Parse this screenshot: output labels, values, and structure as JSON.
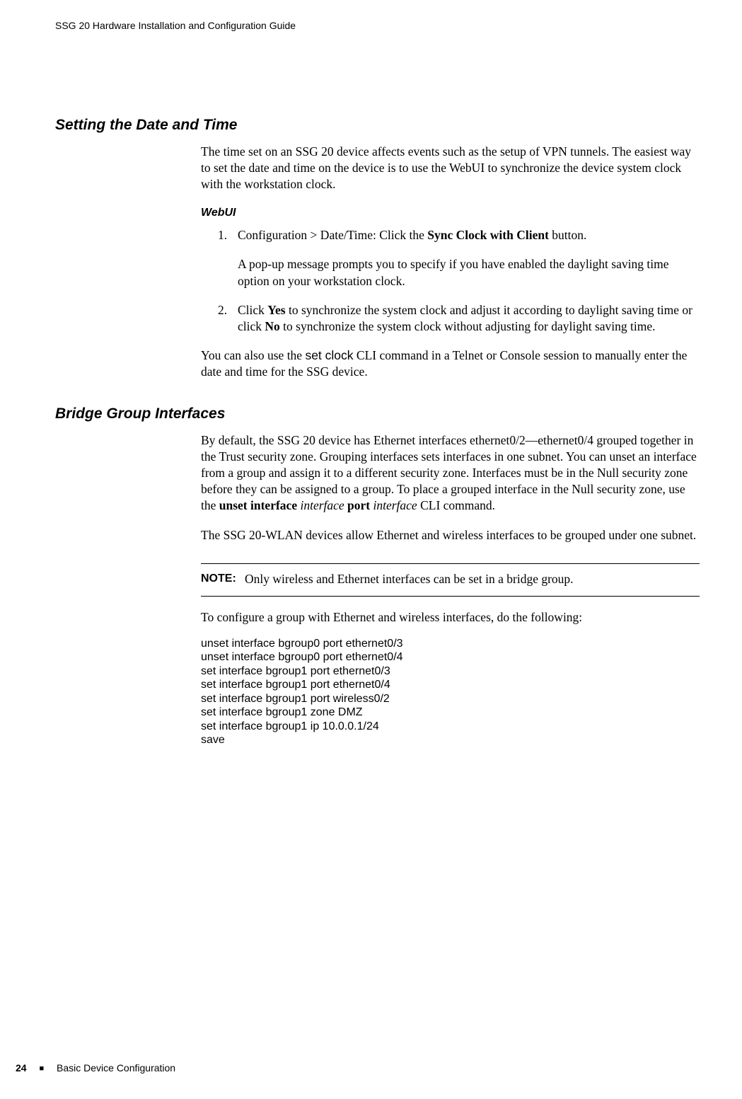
{
  "header": {
    "running_title": "SSG 20 Hardware Installation and Configuration Guide"
  },
  "sections": {
    "date_time": {
      "heading": "Setting the Date and Time",
      "intro": "The time set on an SSG 20 device affects events such as the setup of VPN tunnels. The easiest way to set the date and time on the device is to use the WebUI to synchronize the device system clock with the workstation clock.",
      "webui_label": "WebUI",
      "step1_num": "1.",
      "step1_prefix": "Configuration > Date/Time: Click the ",
      "step1_bold": "Sync Clock with Client",
      "step1_suffix": " button.",
      "step1_para2": "A pop-up message prompts you to specify if you have enabled the daylight saving time option on your workstation clock.",
      "step2_num": "2.",
      "step2_prefix": "Click ",
      "step2_bold1": "Yes",
      "step2_mid1": " to synchronize the system clock and adjust it according to daylight saving time or click ",
      "step2_bold2": "No",
      "step2_mid2": " to synchronize the system clock without adjusting for daylight saving time.",
      "cli_para_prefix": "You can also use the ",
      "cli_cmd": "set clock",
      "cli_para_suffix": " CLI command in a Telnet or Console session to manually enter the date and time for the SSG device."
    },
    "bgroup": {
      "heading": "Bridge Group Interfaces",
      "p1_pre": "By default, the SSG 20 device has Ethernet interfaces ethernet0/2—ethernet0/4 grouped together in the Trust security zone. Grouping interfaces sets interfaces in one subnet. You can unset an interface from a group and assign it to a different security zone. Interfaces must be in the Null security zone before they can be assigned to a group. To place a grouped interface in the Null security zone, use the ",
      "p1_bold1": "unset interface",
      "p1_ital1": " interface ",
      "p1_bold2": "port",
      "p1_ital2": " interface",
      "p1_post": " CLI command.",
      "p2": "The SSG 20-WLAN devices allow Ethernet and wireless interfaces to be grouped under one subnet.",
      "note_label": "NOTE:",
      "note_text": "Only wireless and Ethernet interfaces can be set in a bridge group.",
      "p3": "To configure a group with Ethernet and wireless interfaces, do the following:",
      "cli": [
        "unset interface bgroup0 port ethernet0/3",
        "unset interface bgroup0 port ethernet0/4",
        "set interface bgroup1 port ethernet0/3",
        "set interface bgroup1 port ethernet0/4",
        "set interface bgroup1 port wireless0/2",
        "set interface bgroup1 zone DMZ",
        "set interface bgroup1 ip 10.0.0.1/24",
        "save"
      ]
    }
  },
  "footer": {
    "page_number": "24",
    "bullet": "■",
    "section_name": "Basic Device Configuration"
  }
}
